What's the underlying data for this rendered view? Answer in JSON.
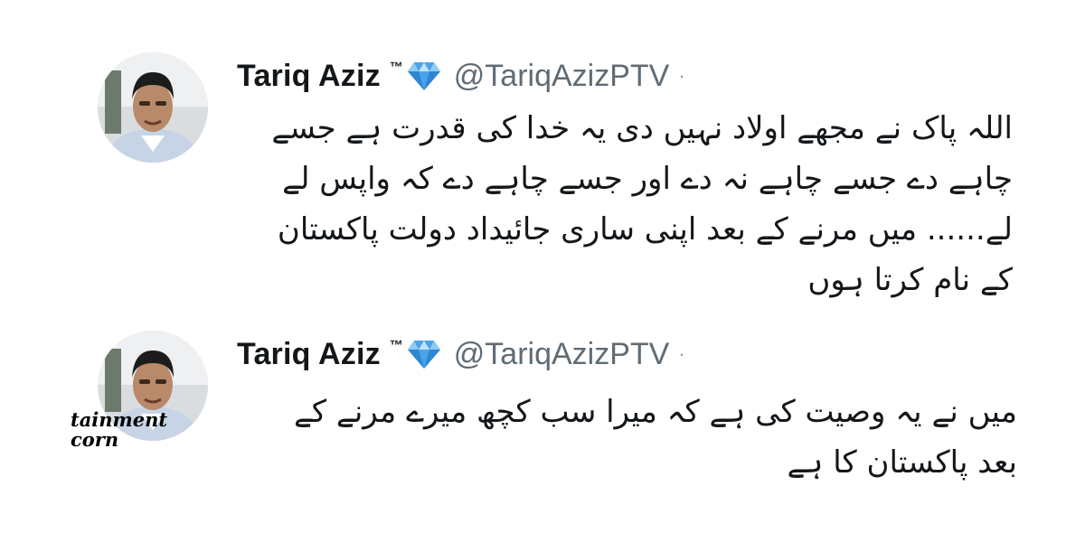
{
  "tweets": [
    {
      "display_name": "Tariq Aziz",
      "trademark": "™",
      "handle": "@TariqAzizPTV",
      "separator": "·",
      "badge_icon": "diamond-icon",
      "lines": [
        "اللہ پاک نے مجھے اولاد نہیں دی یہ خدا کی قدرت ہے جسے",
        "چاہے دے جسے چاہے نہ دے اور جسے چاہے دے کہ واپس لے",
        "لے...... میں مرنے کے بعد اپنی ساری جائیداد دولت پاکستان",
        "کے نام کرتا ہوں"
      ]
    },
    {
      "display_name": "Tariq Aziz",
      "trademark": "™",
      "handle": "@TariqAzizPTV",
      "separator": "·",
      "badge_icon": "diamond-icon",
      "lines": [
        "میں نے یہ وصیت کی ہے کہ میرا سب کچھ میرے مرنے کے",
        "بعد پاکستان کا ہے"
      ],
      "watermark": [
        "tainment",
        "corn"
      ]
    }
  ],
  "colors": {
    "name": "#14171a",
    "handle": "#5f6b75",
    "diamond": "#4aa3e8"
  }
}
